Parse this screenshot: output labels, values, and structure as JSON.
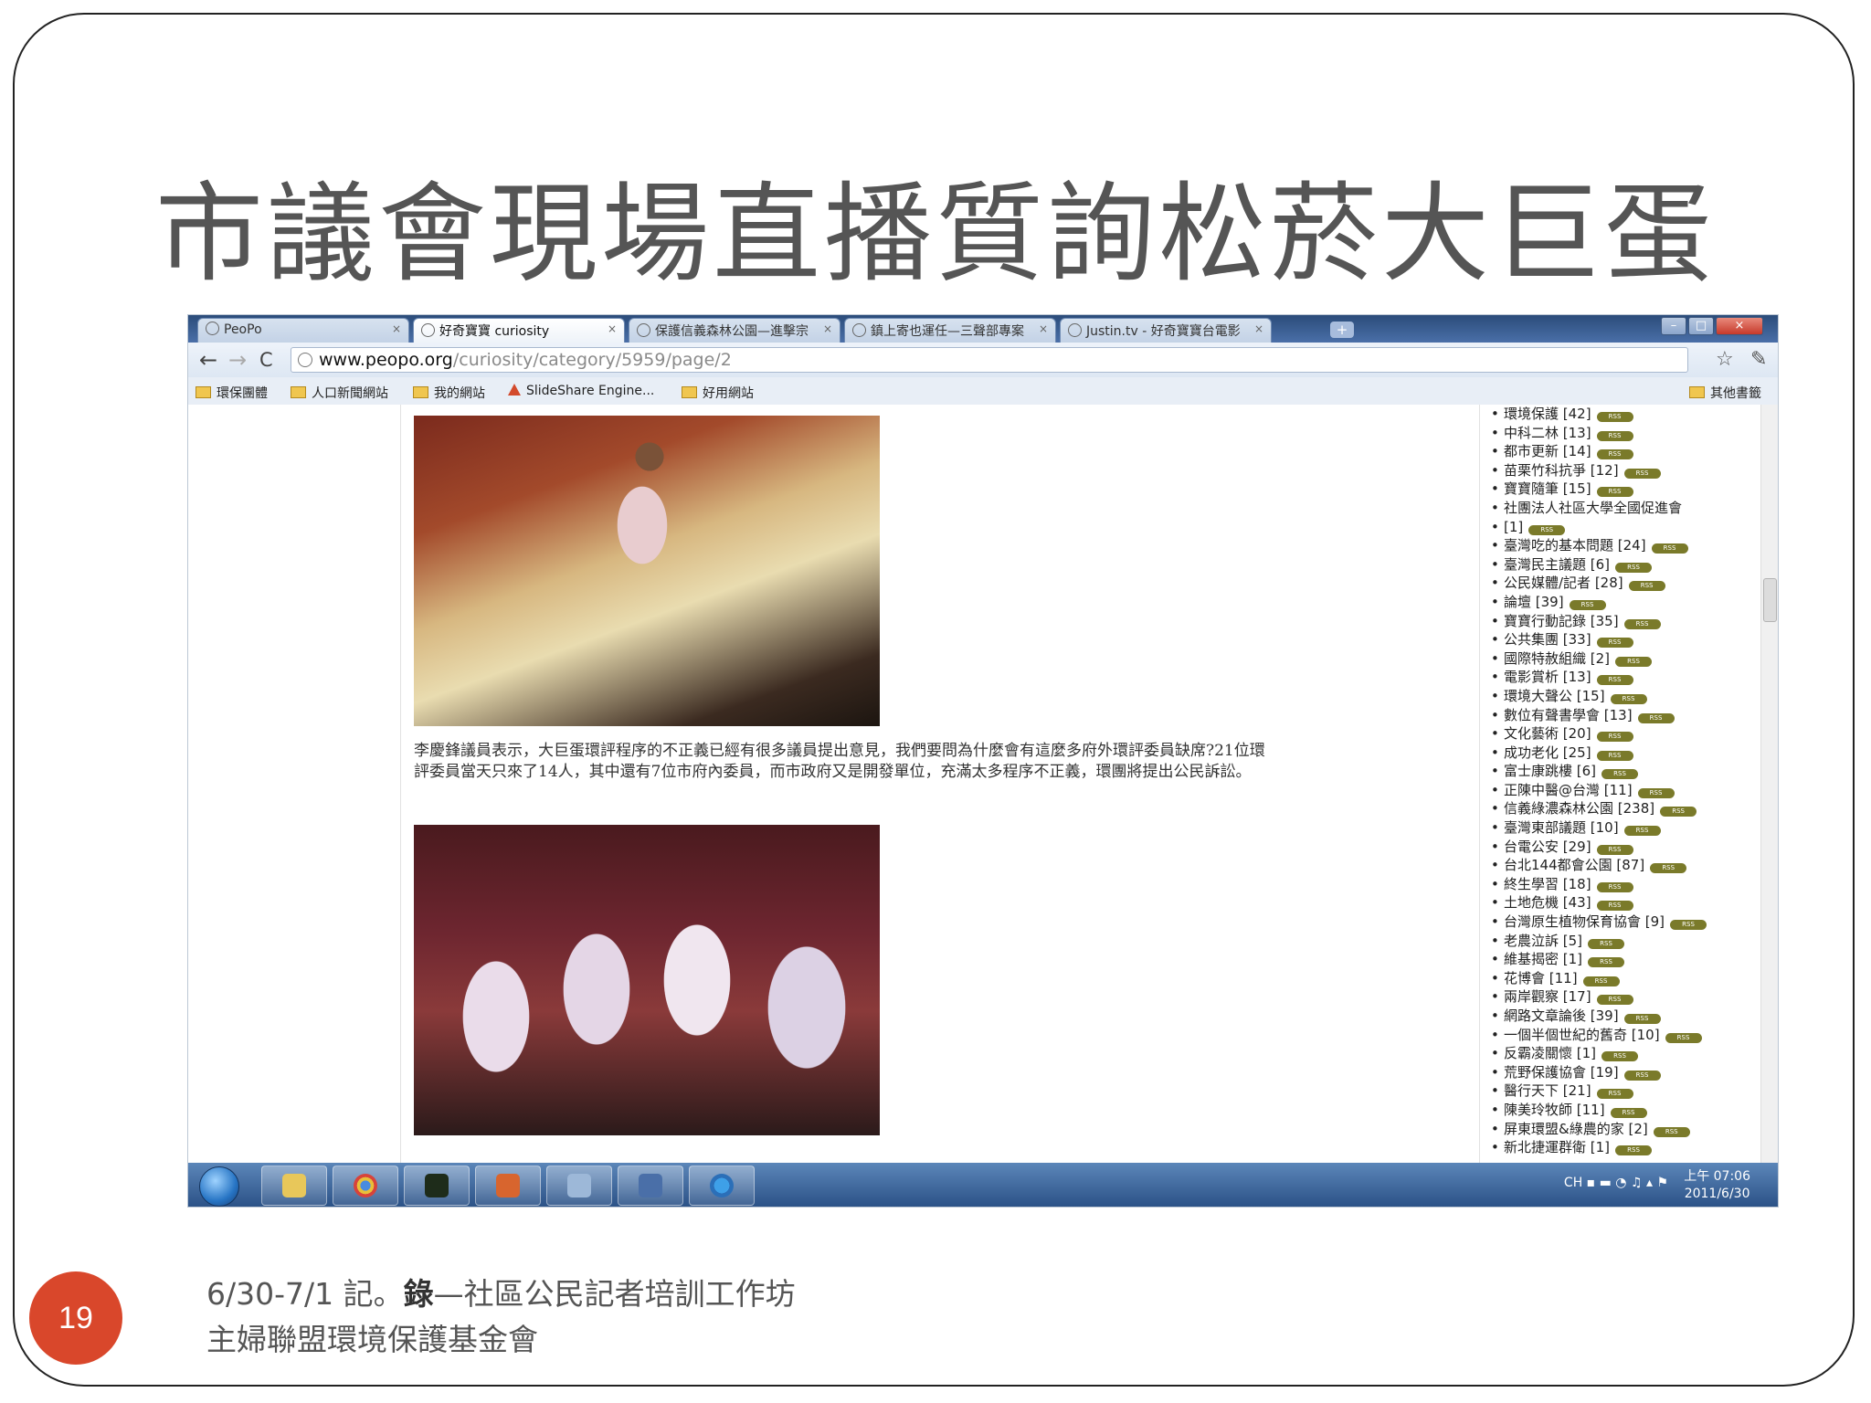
{
  "slide": {
    "title": "市議會現場直播質詢松菸大巨蛋",
    "page_number": "19",
    "footer_line1_date": "6/30-7/1 記。",
    "footer_line1_bold": "錄",
    "footer_line1_rest": "—社區公民記者培訓工作坊",
    "footer_line2": "主婦聯盟環境保護基金會"
  },
  "browser": {
    "tabs": [
      {
        "label": "PeoPo",
        "active": false
      },
      {
        "label": "好奇寶寶 curiosity",
        "active": true
      },
      {
        "label": "保護信義森林公園—進擊宗",
        "active": false
      },
      {
        "label": "鎮上寄也運任—三聲部專案",
        "active": false
      },
      {
        "label": "Justin.tv - 好奇寶寶台電影",
        "active": false
      }
    ],
    "new_tab": "+",
    "url_domain": "www.peopo.org",
    "url_path": "/curiosity/category/5959/page/2",
    "bookmarks": [
      "環保團體",
      "人口新聞網站",
      "我的網站",
      "SlideShare Engine...",
      "好用網站"
    ],
    "other_bookmarks": "其他書籤"
  },
  "article": {
    "paragraph": "李慶鋒議員表示，大巨蛋環評程序的不正義已經有很多議員提出意見，我們要問為什麼會有這麼多府外環評委員缺席?21位環評委員當天只來了14人，其中還有7位市府內委員，而市政府又是開發單位，充滿太多程序不正義，環團將提出公民訴訟。"
  },
  "sidebar": {
    "categories": [
      {
        "label": "環境保護 [42]",
        "rss": true
      },
      {
        "label": "中科二林 [13]",
        "rss": true
      },
      {
        "label": "都市更新 [14]",
        "rss": true
      },
      {
        "label": "苗栗竹科抗爭 [12]",
        "rss": true
      },
      {
        "label": "寶寶隨筆 [15]",
        "rss": true
      },
      {
        "label": "社團法人社區大學全國促進會",
        "rss": false
      },
      {
        "label": "[1]",
        "rss": true
      },
      {
        "label": "臺灣吃的基本問題 [24]",
        "rss": true
      },
      {
        "label": "臺灣民主議題 [6]",
        "rss": true
      },
      {
        "label": "公民媒體/記者 [28]",
        "rss": true
      },
      {
        "label": "論壇 [39]",
        "rss": true
      },
      {
        "label": "寶寶行動記錄 [35]",
        "rss": true
      },
      {
        "label": "公共集團 [33]",
        "rss": true
      },
      {
        "label": "國際特赦組織 [2]",
        "rss": true
      },
      {
        "label": "電影賞析 [13]",
        "rss": true
      },
      {
        "label": "環境大聲公 [15]",
        "rss": true
      },
      {
        "label": "數位有聲書學會 [13]",
        "rss": true
      },
      {
        "label": "文化藝術 [20]",
        "rss": true
      },
      {
        "label": "成功老化 [25]",
        "rss": true
      },
      {
        "label": "富士康跳樓 [6]",
        "rss": true
      },
      {
        "label": "正陳中醫@台灣 [11]",
        "rss": true
      },
      {
        "label": "信義綠濃森林公園 [238]",
        "rss": true
      },
      {
        "label": "臺灣東部議題 [10]",
        "rss": true
      },
      {
        "label": "台電公安 [29]",
        "rss": true
      },
      {
        "label": "台北144都會公園 [87]",
        "rss": true
      },
      {
        "label": "終生學習 [18]",
        "rss": true
      },
      {
        "label": "土地危機 [43]",
        "rss": true
      },
      {
        "label": "台灣原生植物保育協會 [9]",
        "rss": true
      },
      {
        "label": "老農泣訴 [5]",
        "rss": true
      },
      {
        "label": "維基揭密 [1]",
        "rss": true
      },
      {
        "label": "花博會 [11]",
        "rss": true
      },
      {
        "label": "兩岸觀察 [17]",
        "rss": true
      },
      {
        "label": "網路文章論後 [39]",
        "rss": true
      },
      {
        "label": "一個半個世紀的舊奇 [10]",
        "rss": true
      },
      {
        "label": "反霸凌關懷 [1]",
        "rss": true
      },
      {
        "label": "荒野保護協會 [19]",
        "rss": true
      },
      {
        "label": "醫行天下 [21]",
        "rss": true
      },
      {
        "label": "陳美玲牧師 [11]",
        "rss": true
      },
      {
        "label": "屏東環盟&綠農的家 [2]",
        "rss": true
      },
      {
        "label": "新北捷運群衛 [1]",
        "rss": true
      }
    ],
    "rss_label": "RSS"
  },
  "taskbar": {
    "tray_text": "CH",
    "clock_time": "上午 07:06",
    "clock_date": "2011/6/30"
  },
  "colors": {
    "accent_badge": "#d9472b",
    "title_text": "#555555",
    "browser_chrome": "#4a6fa8"
  }
}
